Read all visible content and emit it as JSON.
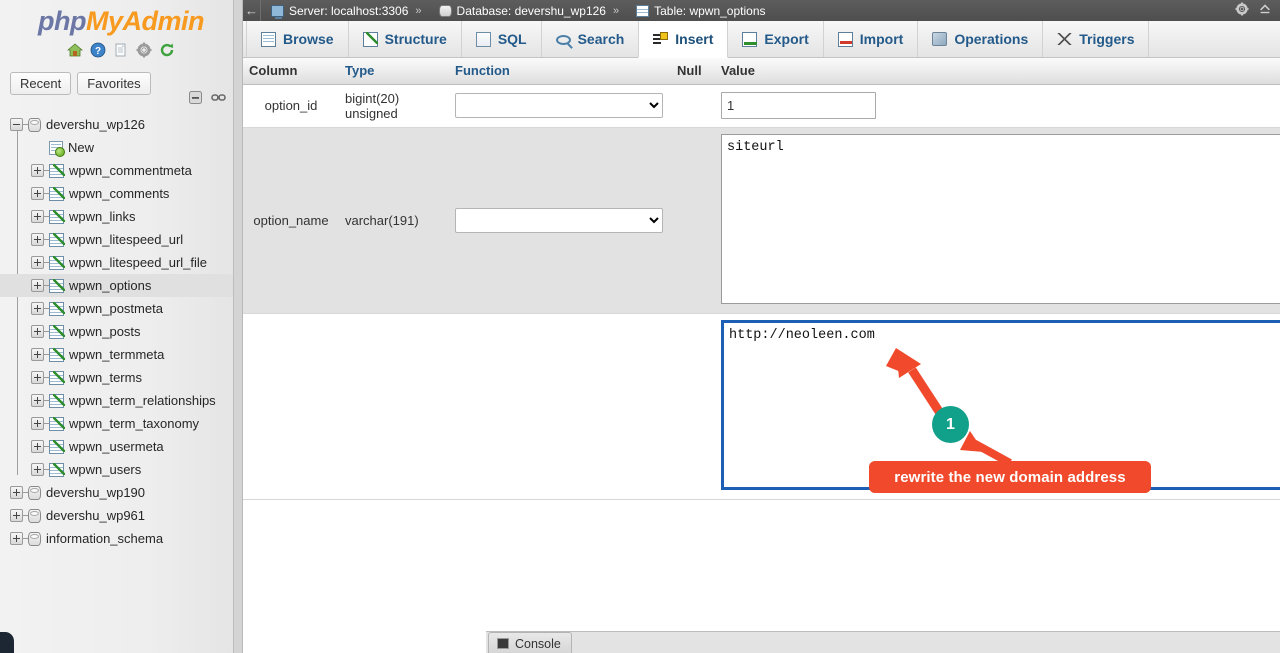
{
  "app": {
    "logo_php": "php",
    "logo_my": "My",
    "logo_admin": "Admin"
  },
  "sidebar": {
    "icons": [
      {
        "name": "home-icon",
        "label": "Home"
      },
      {
        "name": "help-icon",
        "label": "Documentation"
      },
      {
        "name": "copy-icon",
        "label": "Copy"
      },
      {
        "name": "settings-icon",
        "label": "Settings"
      },
      {
        "name": "reload-icon",
        "label": "Reload"
      }
    ],
    "recent_label": "Recent",
    "favorites_label": "Favorites",
    "tools": [
      {
        "name": "collapse-all-icon"
      },
      {
        "name": "chain-link-icon"
      }
    ],
    "tree": [
      {
        "label": "devershu_wp126",
        "level": 0,
        "type": "database",
        "expanded": true,
        "selected": false
      },
      {
        "label": "New",
        "level": 1,
        "type": "new",
        "expanded": false,
        "selected": false
      },
      {
        "label": "wpwn_commentmeta",
        "level": 1,
        "type": "table",
        "expanded": false,
        "selected": false
      },
      {
        "label": "wpwn_comments",
        "level": 1,
        "type": "table",
        "expanded": false,
        "selected": false
      },
      {
        "label": "wpwn_links",
        "level": 1,
        "type": "table",
        "expanded": false,
        "selected": false
      },
      {
        "label": "wpwn_litespeed_url",
        "level": 1,
        "type": "table",
        "expanded": false,
        "selected": false
      },
      {
        "label": "wpwn_litespeed_url_file",
        "level": 1,
        "type": "table",
        "expanded": false,
        "selected": false
      },
      {
        "label": "wpwn_options",
        "level": 1,
        "type": "table",
        "expanded": false,
        "selected": true
      },
      {
        "label": "wpwn_postmeta",
        "level": 1,
        "type": "table",
        "expanded": false,
        "selected": false
      },
      {
        "label": "wpwn_posts",
        "level": 1,
        "type": "table",
        "expanded": false,
        "selected": false
      },
      {
        "label": "wpwn_termmeta",
        "level": 1,
        "type": "table",
        "expanded": false,
        "selected": false
      },
      {
        "label": "wpwn_terms",
        "level": 1,
        "type": "table",
        "expanded": false,
        "selected": false
      },
      {
        "label": "wpwn_term_relationships",
        "level": 1,
        "type": "table",
        "expanded": false,
        "selected": false
      },
      {
        "label": "wpwn_term_taxonomy",
        "level": 1,
        "type": "table",
        "expanded": false,
        "selected": false
      },
      {
        "label": "wpwn_usermeta",
        "level": 1,
        "type": "table",
        "expanded": false,
        "selected": false
      },
      {
        "label": "wpwn_users",
        "level": 1,
        "type": "table",
        "expanded": false,
        "selected": false
      },
      {
        "label": "devershu_wp190",
        "level": 0,
        "type": "database",
        "expanded": false,
        "selected": false
      },
      {
        "label": "devershu_wp961",
        "level": 0,
        "type": "database",
        "expanded": false,
        "selected": false
      },
      {
        "label": "information_schema",
        "level": 0,
        "type": "database",
        "expanded": false,
        "selected": false
      }
    ]
  },
  "serverbar": {
    "back_arrow": "←",
    "crumbs": [
      {
        "icon": "monitor-icon",
        "text": "Server: localhost:3306"
      },
      {
        "icon": "database-icon",
        "text": "Database: devershu_wp126"
      },
      {
        "icon": "table-icon",
        "text": "Table: wpwn_options"
      }
    ],
    "separator": "»",
    "right_icons": [
      {
        "name": "gear-icon"
      },
      {
        "name": "collapse-navigation-icon"
      }
    ]
  },
  "tabs": [
    {
      "label": "Browse",
      "icon": "browse-icon",
      "active": false
    },
    {
      "label": "Structure",
      "icon": "structure-icon",
      "active": false
    },
    {
      "label": "SQL",
      "icon": "sql-icon",
      "active": false
    },
    {
      "label": "Search",
      "icon": "search-icon",
      "active": false
    },
    {
      "label": "Insert",
      "icon": "insert-icon",
      "active": true
    },
    {
      "label": "Export",
      "icon": "export-icon",
      "active": false
    },
    {
      "label": "Import",
      "icon": "import-icon",
      "active": false
    },
    {
      "label": "Operations",
      "icon": "operations-icon",
      "active": false
    },
    {
      "label": "Triggers",
      "icon": "triggers-icon",
      "active": false
    }
  ],
  "insert_table": {
    "headers": {
      "column": "Column",
      "type": "Type",
      "function": "Function",
      "null": "Null",
      "value": "Value"
    },
    "rows": [
      {
        "column": "option_id",
        "type": "bigint(20) unsigned",
        "function_value": "",
        "null_checked": false,
        "value": "1",
        "input_kind": "text"
      },
      {
        "column": "option_name",
        "type": "varchar(191)",
        "function_value": "",
        "null_checked": false,
        "value": "siteurl",
        "input_kind": "textarea"
      },
      {
        "column": "",
        "type": "",
        "function_value": "",
        "null_checked": false,
        "value": "http://neoleen.com",
        "input_kind": "textarea-focused"
      }
    ]
  },
  "console": {
    "label": "Console",
    "icon": "console-icon"
  },
  "annotation": {
    "badge_number": "1",
    "callout_text": "rewrite the new domain address",
    "callout_color": "#f0492b",
    "badge_color": "#11a08a",
    "arrow_color": "#f0492b"
  }
}
